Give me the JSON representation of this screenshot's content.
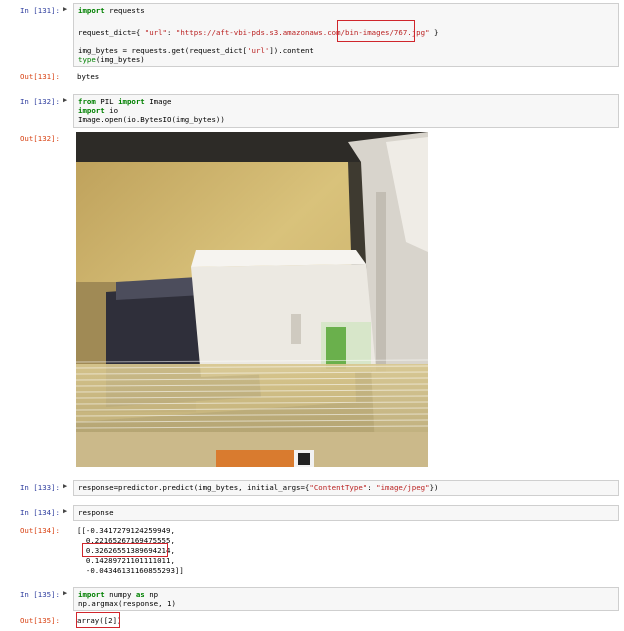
{
  "cells": {
    "c131": {
      "in": "In [131]:",
      "out": "Out[131]:",
      "lines": [
        "import requests",
        "request_dict={ \"url\": \"https://aft-vbi-pds.s3.amazonaws.com/bin-images/767.jpg\" }",
        "img_bytes = requests.get(request_dict['url']).content",
        "type(img_bytes)"
      ],
      "output": "bytes"
    },
    "c132": {
      "in": "In [132]:",
      "out": "Out[132]:",
      "lines": [
        "from PIL import Image",
        "import io",
        "Image.open(io.BytesIO(img_bytes))"
      ]
    },
    "c133": {
      "in": "In [133]:",
      "lines": [
        "response=predictor.predict(img_bytes, initial_args={\"ContentType\": \"image/jpeg\"})"
      ]
    },
    "c134": {
      "in": "In [134]:",
      "out": "Out[134]:",
      "lines": [
        "response"
      ],
      "output_lines": [
        "[[-0.3417279124259949,",
        "  0.22165267169475555,",
        "  0.32626551389694214,",
        "  0.14289721101111011,",
        "  -0.04346131160855293]]"
      ]
    },
    "c135": {
      "in": "In [135]:",
      "out": "Out[135]:",
      "lines": [
        "import numpy as np",
        "np.argmax(response, 1)"
      ],
      "output": "array([2])"
    }
  },
  "run_icon": "run-indicator-icon",
  "highlight_color": "#d0262c"
}
